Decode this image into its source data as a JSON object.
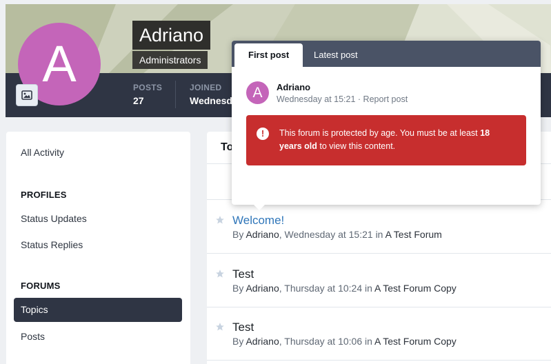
{
  "profile": {
    "avatar_letter": "A",
    "name": "Adriano",
    "group": "Administrators",
    "stats": [
      {
        "label": "POSTS",
        "value": "27"
      },
      {
        "label": "JOINED",
        "value": "Wednesday"
      }
    ]
  },
  "sidebar": {
    "all_activity": "All Activity",
    "profiles_heading": "PROFILES",
    "status_updates": "Status Updates",
    "status_replies": "Status Replies",
    "forums_heading": "FORUMS",
    "topics": "Topics",
    "posts": "Posts"
  },
  "main": {
    "title": "To",
    "rows": [
      {
        "title": "Welcome!",
        "by": "By ",
        "author": "Adriano",
        "time": ", Wednesday at 15:21 in ",
        "forum": "A Test Forum"
      },
      {
        "title": "Test",
        "by": "By ",
        "author": "Adriano",
        "time": ", Thursday at 10:24 in ",
        "forum": "A Test Forum Copy"
      },
      {
        "title": "Test",
        "by": "By ",
        "author": "Adriano",
        "time": ", Thursday at 10:06 in ",
        "forum": "A Test Forum Copy"
      }
    ]
  },
  "hovercard": {
    "tabs": [
      "First post",
      "Latest post"
    ],
    "avatar_letter": "A",
    "author": "Adriano",
    "time": "Wednesday at 15:21",
    "separator": " · ",
    "report": "Report post",
    "alert_icon": "!",
    "alert_text_1": "This forum is protected by age. You must be at least ",
    "alert_text_bold": "18 years old",
    "alert_text_2": " to view this content."
  },
  "colors": {
    "accent": "#2f76b9",
    "avatar": "#c465b9",
    "header_bar": "#2f3544",
    "alert": "#c72e2e"
  }
}
